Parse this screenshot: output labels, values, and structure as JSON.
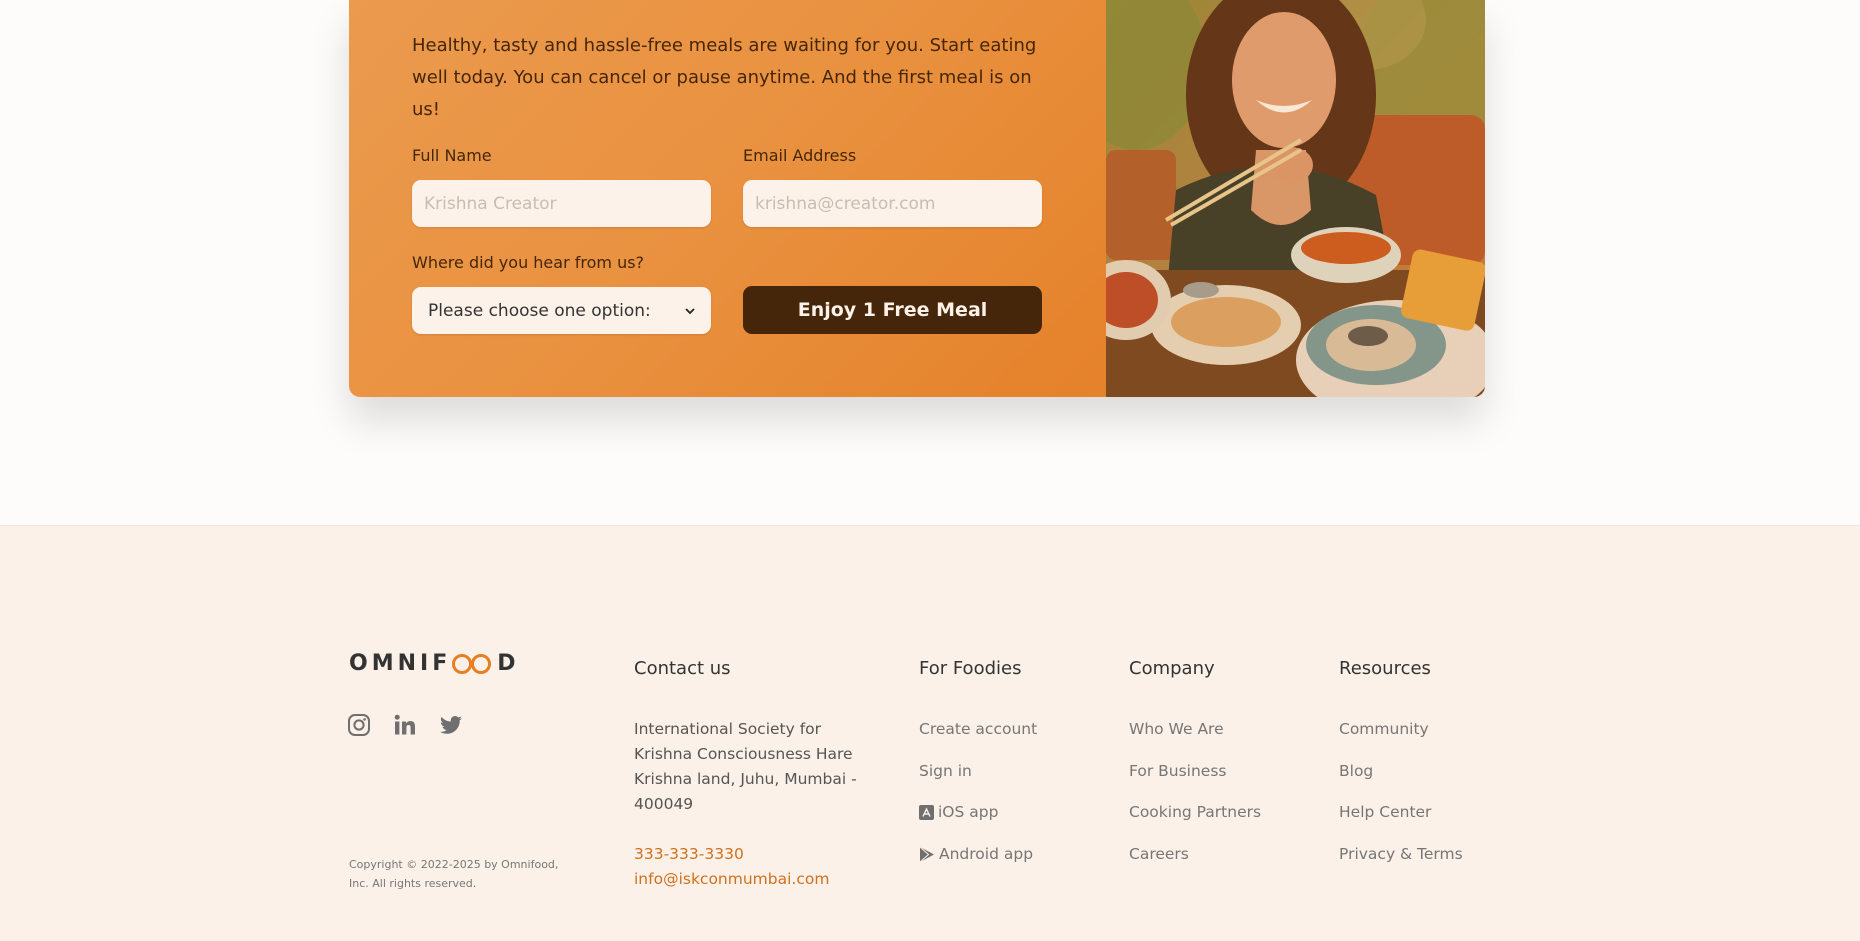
{
  "cta": {
    "description": "Healthy, tasty and hassle-free meals are waiting for you. Start eating well today. You can cancel or pause anytime. And the first meal is on us!",
    "full_name_label": "Full Name",
    "full_name_placeholder": "Krishna Creator",
    "email_label": "Email Address",
    "email_placeholder": "krishna@creator.com",
    "source_label": "Where did you hear from us?",
    "source_selected": "Please choose one option:",
    "submit_label": "Enjoy 1 Free Meal",
    "image_alt": "Woman enjoying food, meals in storage container, and food bowls on a table"
  },
  "footer": {
    "logo": {
      "pre": "OMNIF",
      "post": "D"
    },
    "social": [
      "instagram-icon",
      "linkedin-icon",
      "twitter-icon"
    ],
    "copyright": "Copyright © 2022-2025 by Omnifood, Inc. All rights reserved.",
    "contact": {
      "heading": "Contact us",
      "address": "International Society for Krishna Consciousness Hare Krishna land, Juhu, Mumbai - 400049",
      "phone": "333-333-3330",
      "email": "info@iskconmumbai.com"
    },
    "foodies": {
      "heading": "For Foodies",
      "items": [
        "Create account",
        "Sign in",
        "iOS app",
        "Android app"
      ]
    },
    "company": {
      "heading": "Company",
      "items": [
        "Who We Are",
        "For Business",
        "Cooking Partners",
        "Careers"
      ]
    },
    "resources": {
      "heading": "Resources",
      "items": [
        "Community",
        "Blog",
        "Help Center",
        "Privacy & Terms"
      ]
    }
  },
  "colors": {
    "accent": "#e67e22",
    "dark_brown": "#45260a",
    "footer_bg": "#fcf1e8"
  }
}
